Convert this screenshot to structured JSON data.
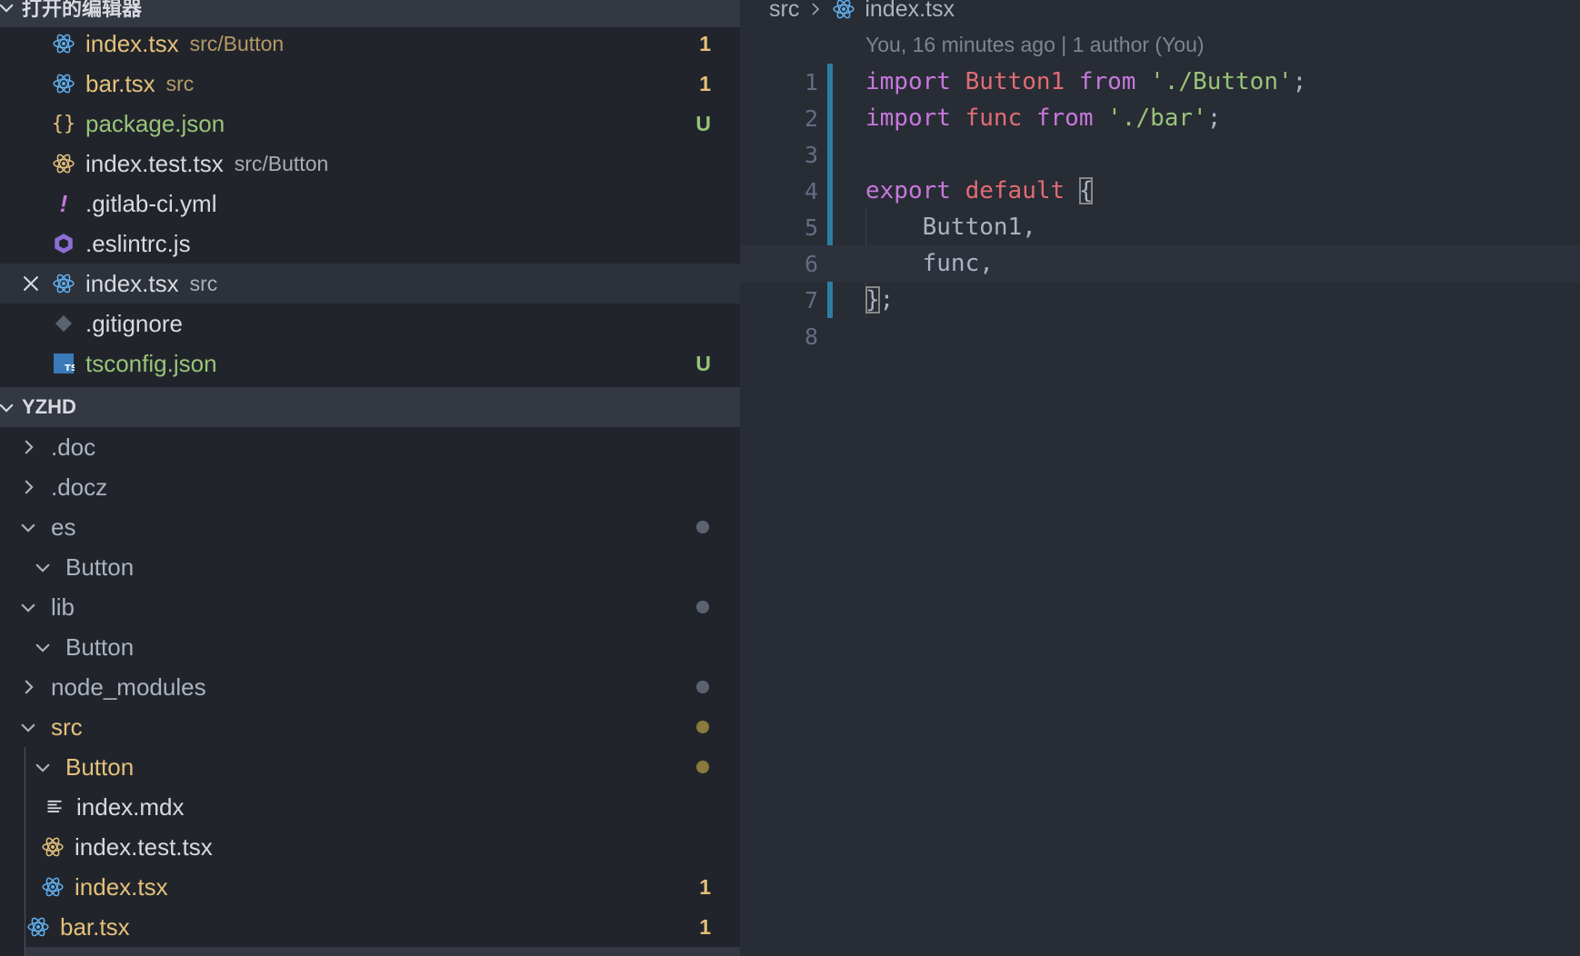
{
  "open_editors": {
    "title": "打开的编辑器",
    "items": [
      {
        "name": "index.tsx",
        "desc": "src/Button",
        "badge": "1",
        "icon": "react-icon",
        "color": "#e5c07b"
      },
      {
        "name": "bar.tsx",
        "desc": "src",
        "badge": "1",
        "icon": "react-icon",
        "color": "#e5c07b"
      },
      {
        "name": "package.json",
        "desc": "",
        "badge": "U",
        "icon": "json-braces-icon",
        "color": "#98c379"
      },
      {
        "name": "index.test.tsx",
        "desc": "src/Button",
        "badge": "",
        "icon": "react-test-icon",
        "color": "#d7dae0"
      },
      {
        "name": ".gitlab-ci.yml",
        "desc": "",
        "badge": "",
        "icon": "exclamation-icon",
        "color": "#d7dae0"
      },
      {
        "name": ".eslintrc.js",
        "desc": "",
        "badge": "",
        "icon": "eslint-icon",
        "color": "#d7dae0"
      },
      {
        "name": "index.tsx",
        "desc": "src",
        "badge": "",
        "icon": "react-icon",
        "color": "#d7dae0"
      },
      {
        "name": ".gitignore",
        "desc": "",
        "badge": "",
        "icon": "git-icon",
        "color": "#d7dae0"
      },
      {
        "name": "tsconfig.json",
        "desc": "",
        "badge": "U",
        "icon": "typescript-icon",
        "color": "#98c379"
      }
    ]
  },
  "explorer": {
    "title": "YZHD",
    "items": [
      {
        "name": ".doc",
        "type": "folder-collapsed"
      },
      {
        "name": ".docz",
        "type": "folder-collapsed"
      },
      {
        "name": "es",
        "type": "folder-expanded"
      },
      {
        "name": "Button",
        "type": "folder-expanded"
      },
      {
        "name": "lib",
        "type": "folder-expanded"
      },
      {
        "name": "Button",
        "type": "folder-expanded"
      },
      {
        "name": "node_modules",
        "type": "folder-collapsed"
      },
      {
        "name": "src",
        "type": "folder-expanded"
      },
      {
        "name": "Button",
        "type": "folder-expanded"
      },
      {
        "name": "index.mdx",
        "type": "file"
      },
      {
        "name": "index.test.tsx",
        "type": "file"
      },
      {
        "name": "index.tsx",
        "type": "file",
        "badge": "1"
      },
      {
        "name": "bar.tsx",
        "type": "file",
        "badge": "1"
      }
    ]
  },
  "editor": {
    "breadcrumb": [
      "src",
      "index.tsx"
    ],
    "blame": "You, 16 minutes ago | 1 author (You)",
    "line_numbers": [
      "1",
      "2",
      "3",
      "4",
      "5",
      "6",
      "7",
      "8"
    ],
    "tokens": {
      "l1": [
        "import",
        " ",
        "Button1",
        " ",
        "from",
        " ",
        "'./Button'",
        ";"
      ],
      "l2": [
        "import",
        " ",
        "func",
        " ",
        "from",
        " ",
        "'./bar'",
        ";"
      ],
      "l4": [
        "export",
        " ",
        "default",
        " ",
        "{"
      ],
      "l5": [
        "    Button1,"
      ],
      "l6": [
        "    func,"
      ],
      "l7": [
        "}",
        ";"
      ]
    }
  },
  "colors": {
    "sidebar_bg": "#21252b",
    "editor_bg": "#282c34",
    "modified": "#e5c07b",
    "untracked": "#98c379",
    "keyword": "#c678dd",
    "variable": "#e06c75",
    "string": "#98c379"
  }
}
